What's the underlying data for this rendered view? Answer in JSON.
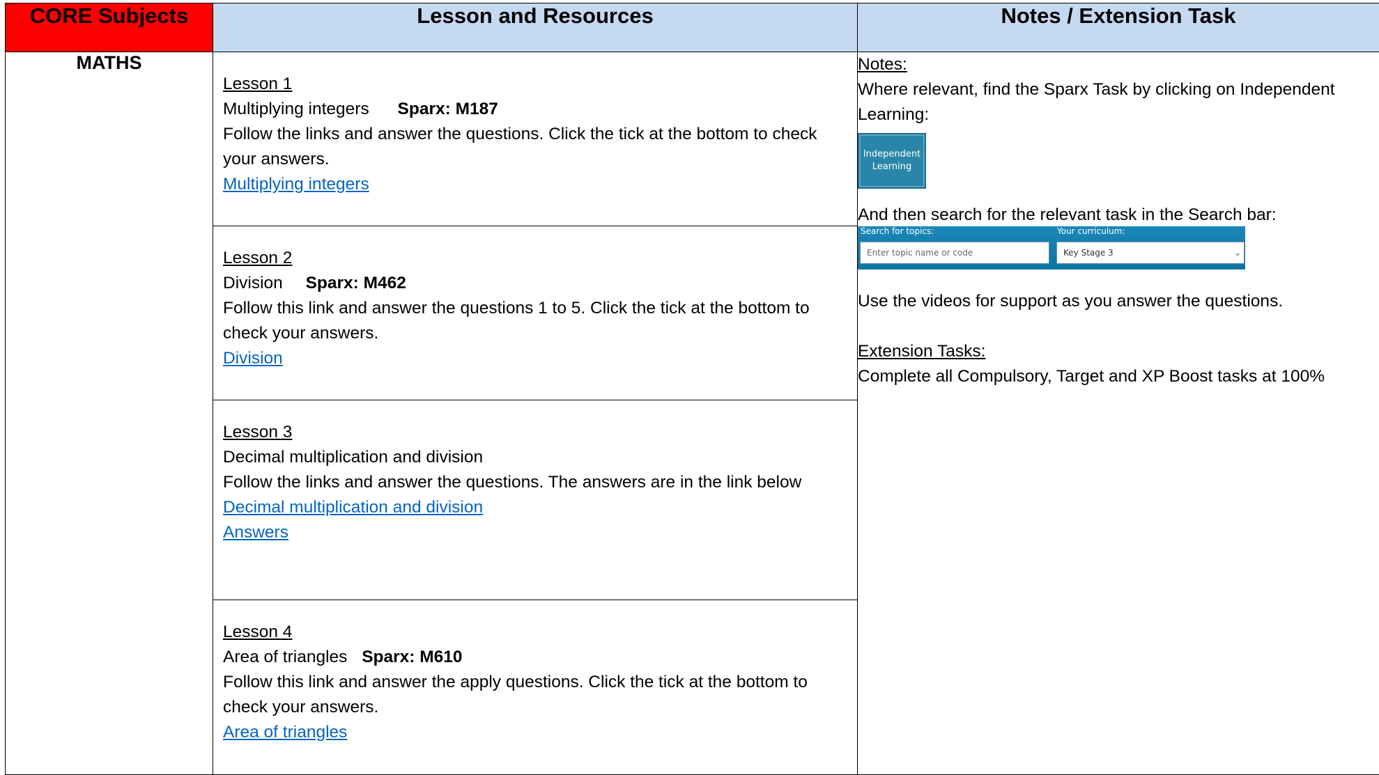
{
  "header": {
    "core": "CORE Subjects",
    "lesson": "Lesson and Resources",
    "notes": "Notes / Extension Task"
  },
  "subject": "MATHS",
  "lessons": [
    {
      "heading": "Lesson 1",
      "topic": "Multiplying integers",
      "sparx": "Sparx: M187",
      "instructions": "Follow the links and answer the questions. Click the tick at the bottom to check your answers.",
      "links": [
        "Multiplying integers"
      ]
    },
    {
      "heading": "Lesson 2",
      "topic": "Division",
      "sparx": "Sparx: M462",
      "instructions": "Follow this link and answer the questions 1 to 5. Click the tick at the bottom to check your answers.",
      "links": [
        "Division"
      ]
    },
    {
      "heading": "Lesson 3",
      "topic": "Decimal multiplication and division",
      "sparx": "",
      "instructions": "Follow the links and answer the questions. The answers are in the link below",
      "links": [
        "Decimal multiplication and division",
        "Answers"
      ]
    },
    {
      "heading": "Lesson 4",
      "topic": "Area of triangles",
      "sparx": "Sparx: M610",
      "instructions": "Follow this link and answer the apply questions. Click the tick at the bottom to check your answers.",
      "links": [
        "Area of triangles"
      ]
    }
  ],
  "notes": {
    "heading": "Notes:",
    "line1": "Where relevant, find the Sparx Task by clicking on Independent Learning:",
    "button_line1": "Independent",
    "button_line2": "Learning",
    "line2": "And then search for the relevant task in the Search bar:",
    "search": {
      "topics_label": "Search for topics:",
      "topics_placeholder": "Enter topic name or code",
      "curriculum_label": "Your curriculum:",
      "curriculum_value": "Key Stage 3"
    },
    "line3": "Use the videos for support as you answer the questions.",
    "extension_heading": "Extension Tasks:",
    "extension_text": "Complete all Compulsory, Target and XP Boost tasks at 100%"
  },
  "colors": {
    "core_header": "#ff0000",
    "other_header": "#c5d9f1",
    "link": "#0563c1",
    "sparx_button": "#2a86a8"
  },
  "icons": [
    "chevron-down-icon"
  ]
}
